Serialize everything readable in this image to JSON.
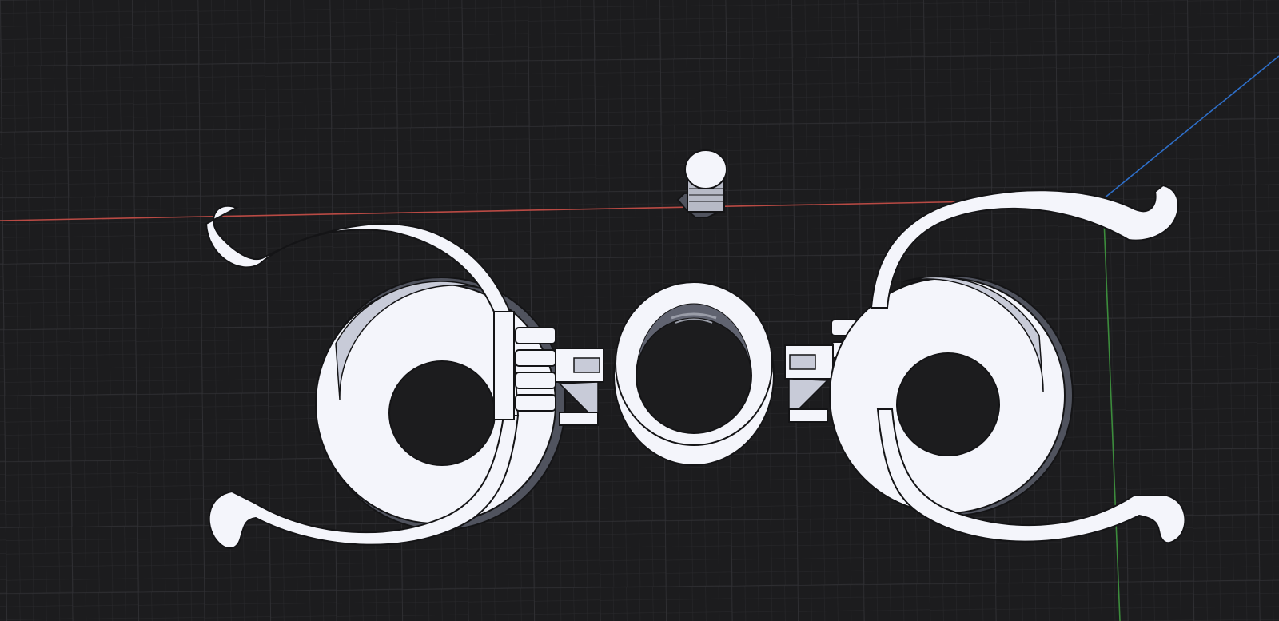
{
  "viewport": {
    "background": "#1c1c1e",
    "grid_minor_color": "#2a2a2d",
    "grid_major_color": "#333337",
    "grid": true
  },
  "axes": {
    "x_axis_color": "#b94a44",
    "y_axis_color": "#3c8c3c",
    "z_axis_color": "#2e6fc9"
  },
  "model": {
    "part_fill": "#f4f5fb",
    "part_shade": "#c8cbd8",
    "edge_color": "#141416",
    "shadow_color": "#50535e"
  }
}
